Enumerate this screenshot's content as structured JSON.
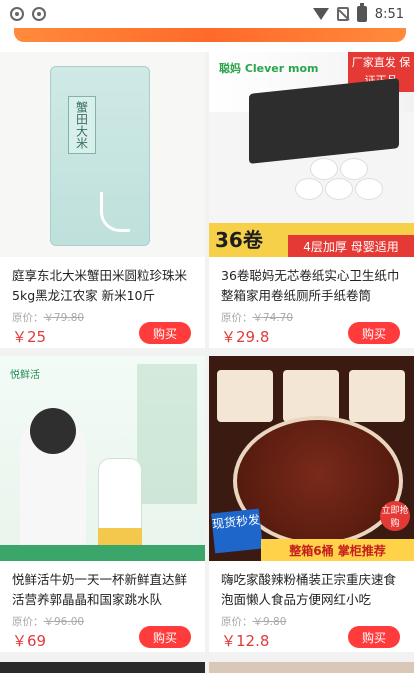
{
  "status_bar": {
    "time": "8:51",
    "icons": [
      "app-icon-1",
      "app-icon-2",
      "wifi-icon",
      "sim-off-icon",
      "battery-icon"
    ]
  },
  "products": [
    {
      "title": "庭享东北大米蟹田米圆粒珍珠米5kg黑龙江农家 新米10斤",
      "orig_label": "原价：",
      "orig_price": "￥79.80",
      "price": "￥25",
      "buy_label": "购买",
      "image_text": "蟹田大米"
    },
    {
      "title": "36卷聪妈无芯卷纸实心卫生纸巾整箱家用卷纸厕所手纸卷筒",
      "orig_label": "原价：",
      "orig_price": "￥74.70",
      "price": "￥29.8",
      "buy_label": "购买",
      "image_text": {
        "brand": "聪妈 Clever mom",
        "badge": "厂家直发 保证正品",
        "count": "36卷",
        "promo": "4层加厚 母婴适用"
      }
    },
    {
      "title": "悦鲜活牛奶一天一杯新鲜直达鲜活营养郭晶晶和国家跳水队",
      "orig_label": "原价：",
      "orig_price": "￥96.00",
      "price": "￥69",
      "buy_label": "购买",
      "image_text": {
        "brand": "悦鲜活"
      }
    },
    {
      "title": "嗨吃家酸辣粉桶装正宗重庆速食泡面懒人食品方便网红小吃",
      "orig_label": "原价：",
      "orig_price": "￥9.80",
      "price": "￥12.8",
      "buy_label": "购买",
      "image_text": {
        "tag1": "现货秒发",
        "tag2": "整箱6桶 掌柜推荐",
        "tag3": "立即抢购"
      }
    }
  ],
  "colors": {
    "price_red": "#e23b3b",
    "buy_button": "#ff3b3b",
    "banner_orange": "#ff6a2a"
  }
}
